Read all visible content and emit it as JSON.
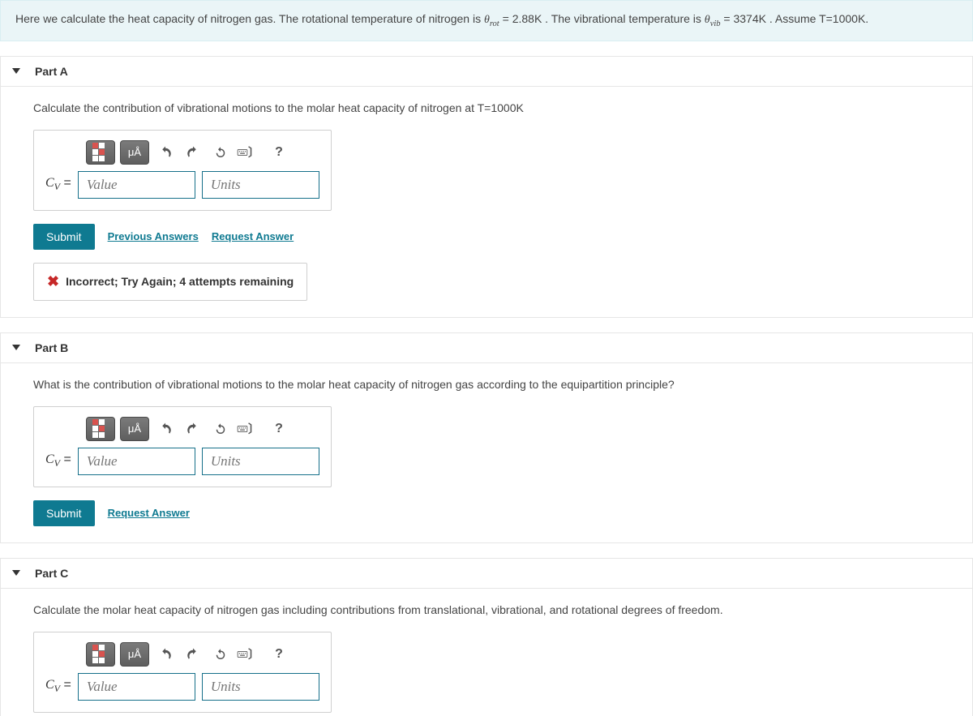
{
  "intro": {
    "prefix": "Here we calculate the heat capacity of nitrogen gas. The rotational temperature of nitrogen is ",
    "theta_rot_sym": "θ",
    "rot_sub": "rot",
    "rot_val": " = 2.88K",
    "middle": ". The vibrational temperature is ",
    "theta_vib_sym": "θ",
    "vib_sub": "vib",
    "vib_val": " = 3374K",
    "suffix": ". Assume T=1000K."
  },
  "common": {
    "value_ph": "Value",
    "units_ph": "Units",
    "submit": "Submit",
    "prev_answers": "Previous Answers",
    "req_answer": "Request Answer",
    "cv_sym": "C",
    "cv_sub": "V",
    "eq": " = ",
    "mu_a": "μÅ",
    "help": "?"
  },
  "partA": {
    "title": "Part A",
    "prompt": "Calculate the contribution of vibrational motions to the molar heat capacity of nitrogen at T=1000K",
    "feedback": "Incorrect; Try Again; 4 attempts remaining"
  },
  "partB": {
    "title": "Part B",
    "prompt": "What is the contribution of vibrational motions to the molar heat capacity of nitrogen gas according to the equipartition principle?"
  },
  "partC": {
    "title": "Part C",
    "prompt": "Calculate the molar heat capacity of nitrogen gas including contributions from translational, vibrational, and rotational degrees of freedom."
  }
}
